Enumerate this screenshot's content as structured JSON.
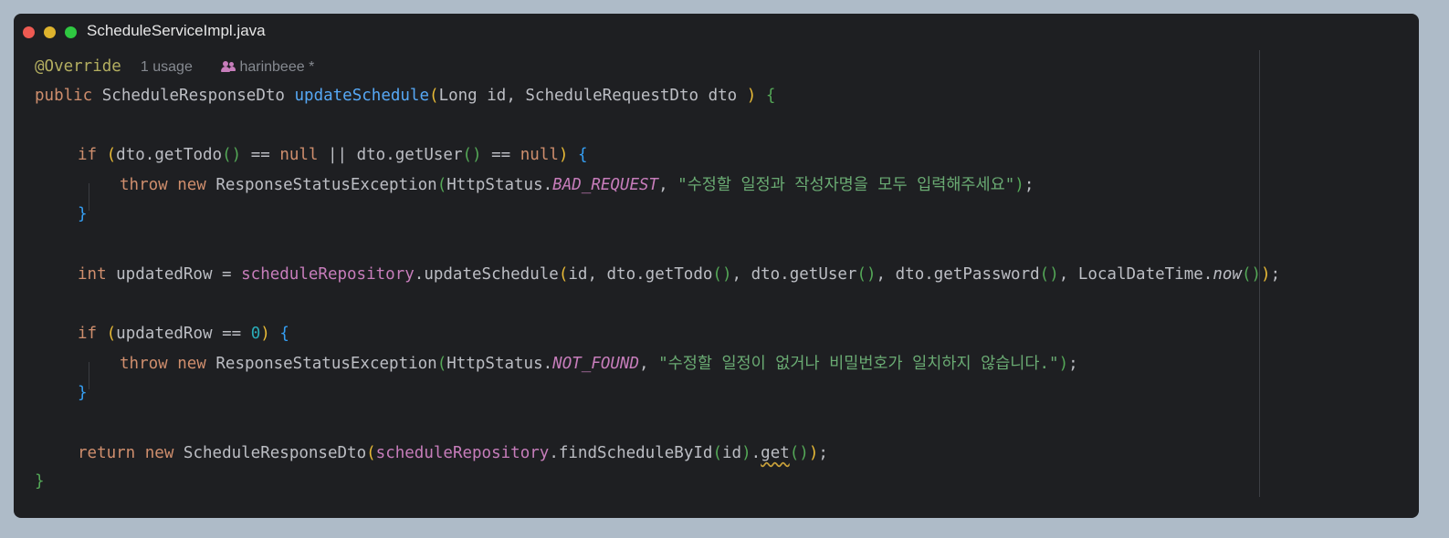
{
  "window": {
    "title": "ScheduleServiceImpl.java"
  },
  "hints": {
    "usages": "1 usage",
    "author": "harinbeee *"
  },
  "code": {
    "annotation": "@Override",
    "kw_public": "public",
    "return_type": "ScheduleResponseDto",
    "method_name": "updateSchedule",
    "params": "Long id, ScheduleRequestDto dto ",
    "kw_if": "if",
    "cond1_a": "dto.getTodo",
    "cond1_b": " == ",
    "kw_null": "null",
    "cond1_c": " || dto.getUser",
    "kw_throw": "throw",
    "kw_new": "new",
    "exception_class": "ResponseStatusException",
    "http_status": "HttpStatus.",
    "bad_request": "BAD_REQUEST",
    "msg1": "\"수정할 일정과 작성자명을 모두 입력해주세요\"",
    "kw_int": "int",
    "var_decl": " updatedRow = ",
    "repo_field": "scheduleRepository",
    "update_call": ".updateSchedule",
    "args_a": "id, dto.getTodo",
    "args_b": ", dto.getUser",
    "args_c": ", dto.getPassword",
    "args_d": ", LocalDateTime.",
    "now_method": "now",
    "cond2": "updatedRow == ",
    "zero": "0",
    "not_found": "NOT_FOUND",
    "msg2": "\"수정할 일정이 없거나 비밀번호가 일치하지 않습니다.\"",
    "kw_return": "return",
    "find_call": ".findScheduleById",
    "id_arg": "id",
    "get_call": "get"
  },
  "colors": {
    "background": "#1e1f22",
    "keyword": "#cf8e6d",
    "function": "#56a8f5",
    "field": "#c77dbb",
    "string": "#6aab73",
    "number": "#2aacb8"
  }
}
